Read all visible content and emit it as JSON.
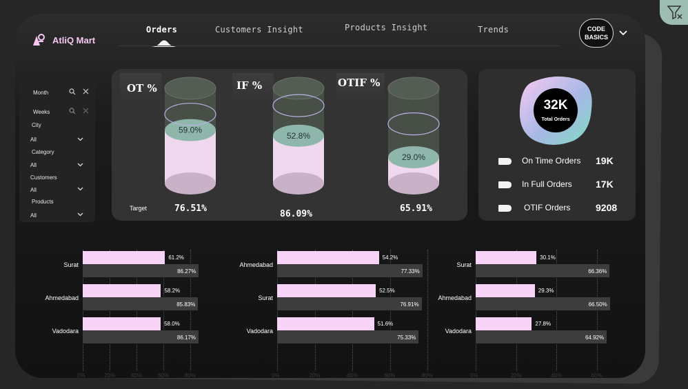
{
  "app": {
    "name": "AtliQ Mart"
  },
  "nav": {
    "tabs": [
      {
        "label": "Orders"
      },
      {
        "label": "Customers Insight"
      },
      {
        "label": "Products Insight"
      },
      {
        "label": "Trends"
      }
    ],
    "badge": {
      "line1": "CODE",
      "line2": "BASICS"
    }
  },
  "slicers": {
    "month": {
      "label": "Month"
    },
    "weeks": {
      "label": "Weeks"
    },
    "city": {
      "label": "City",
      "value": "All"
    },
    "category": {
      "label": "Category",
      "value": "All"
    },
    "customers": {
      "label": "Customers",
      "value": "All"
    },
    "products": {
      "label": "Products",
      "value": "All"
    }
  },
  "gauges": {
    "target_label": "Target",
    "items": [
      {
        "title": "OT %",
        "value_label": "59.0%",
        "value": 59.0,
        "target": "76.51%"
      },
      {
        "title": "IF %",
        "value_label": "52.8%",
        "value": 52.8,
        "target": "86.09%"
      },
      {
        "title": "OTIF %",
        "value_label": "29.0%",
        "value": 29.0,
        "target": "65.91%"
      }
    ]
  },
  "kpi": {
    "total": {
      "value": "32K",
      "label": "Total Orders"
    },
    "rows": [
      {
        "label": "On Time  Orders",
        "value": "19K"
      },
      {
        "label": "In Full Orders",
        "value": "17K"
      },
      {
        "label": "OTIF  Orders",
        "value": "9208"
      }
    ]
  },
  "colors": {
    "accent_pink": "#f6d3f7",
    "teal": "#8fb6ab",
    "logo_pink": "#f7c9f1"
  },
  "chart_data": [
    {
      "type": "bar",
      "orientation": "horizontal",
      "categories": [
        "Surat",
        "Ahmedabad",
        "Vadodara"
      ],
      "series": [
        {
          "values": [
            61.2,
            58.2,
            58.0
          ],
          "labels": [
            "61.2%",
            "58.2%",
            "58.0%"
          ]
        },
        {
          "values": [
            86.27,
            85.83,
            86.17
          ],
          "labels": [
            "86.27%",
            "85.83%",
            "86.17%"
          ]
        }
      ],
      "xlim": [
        0,
        100
      ],
      "ticks": [
        "0%",
        "20%",
        "40%",
        "60%",
        "80%"
      ]
    },
    {
      "type": "bar",
      "orientation": "horizontal",
      "categories": [
        "Ahmedabad",
        "Surat",
        "Vadodara"
      ],
      "series": [
        {
          "values": [
            54.2,
            52.5,
            51.6
          ],
          "labels": [
            "54.2%",
            "52.5%",
            "51.6%"
          ]
        },
        {
          "values": [
            77.33,
            76.91,
            75.33
          ],
          "labels": [
            "77.33%",
            "76.91%",
            "75.33%"
          ]
        }
      ],
      "xlim": [
        0,
        80
      ],
      "ticks": [
        "0%",
        "20%",
        "40%",
        "60%",
        "80%"
      ]
    },
    {
      "type": "bar",
      "orientation": "horizontal",
      "categories": [
        "Surat",
        "Ahmedabad",
        "Vadodara"
      ],
      "series": [
        {
          "values": [
            30.1,
            29.3,
            27.8
          ],
          "labels": [
            "30.1%",
            "29.3%",
            "27.8%"
          ]
        },
        {
          "values": [
            66.36,
            66.5,
            64.92
          ],
          "labels": [
            "66.36%",
            "66.50%",
            "64.92%"
          ]
        }
      ],
      "xlim": [
        0,
        70
      ],
      "ticks": [
        "0%",
        "20%",
        "40%",
        "60%"
      ]
    }
  ]
}
